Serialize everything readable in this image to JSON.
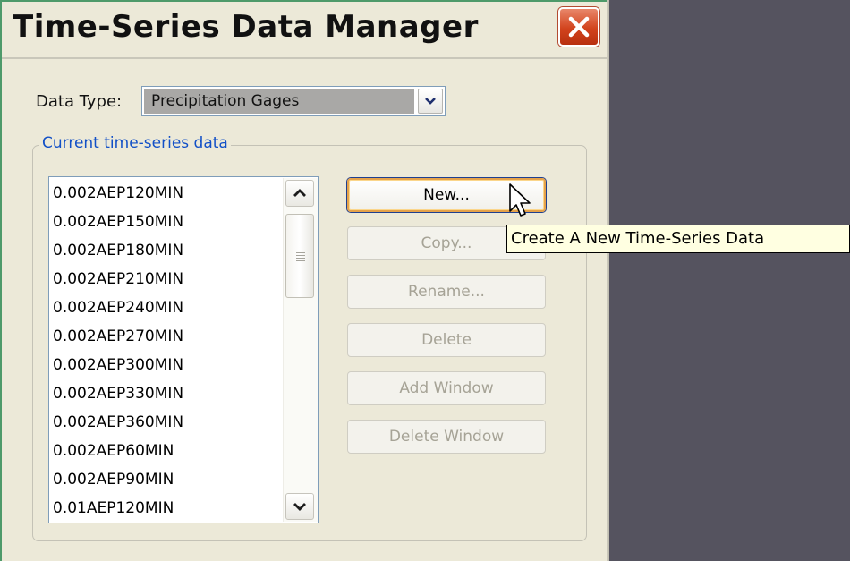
{
  "window": {
    "title": "Time-Series Data Manager"
  },
  "data_type": {
    "label": "Data Type:",
    "selected": "Precipitation Gages"
  },
  "group": {
    "legend": "Current time-series data"
  },
  "list": {
    "items": [
      "0.002AEP120MIN",
      "0.002AEP150MIN",
      "0.002AEP180MIN",
      "0.002AEP210MIN",
      "0.002AEP240MIN",
      "0.002AEP270MIN",
      "0.002AEP300MIN",
      "0.002AEP330MIN",
      "0.002AEP360MIN",
      "0.002AEP60MIN",
      "0.002AEP90MIN",
      "0.01AEP120MIN"
    ]
  },
  "buttons": {
    "new": "New...",
    "copy": "Copy...",
    "rename": "Rename...",
    "delete": "Delete",
    "add_window": "Add Window",
    "delete_window": "Delete Window"
  },
  "tooltip": {
    "text": "Create A New Time-Series Data"
  },
  "icons": {
    "close": "close-icon",
    "dropdown": "chevron-down-icon",
    "scroll_up": "chevron-up-icon",
    "scroll_down": "chevron-down-icon",
    "cursor": "mouse-pointer-icon"
  },
  "colors": {
    "desktop": "#55535f",
    "dialog_bg": "#ece9d8",
    "close_button": "#d2431d",
    "legend_text": "#1250c7",
    "tooltip_bg": "#ffffe1",
    "focus_border": "#e5a24a"
  }
}
